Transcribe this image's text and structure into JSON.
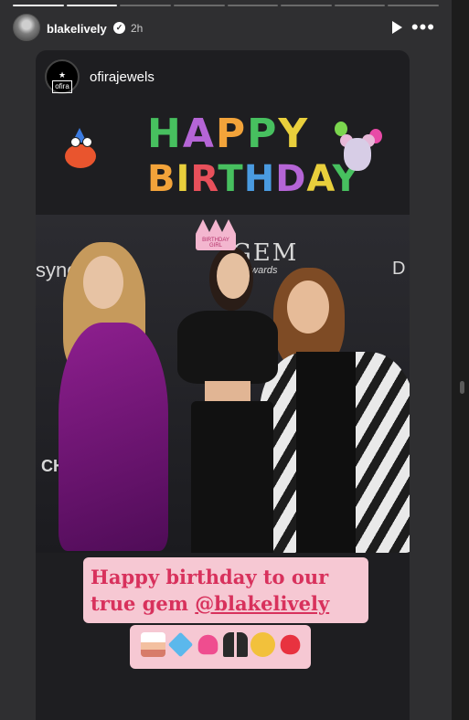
{
  "story": {
    "progress_segments": 8,
    "progress_done": 2,
    "username": "blakelively",
    "verified": true,
    "time": "2h",
    "play_icon": "play-icon",
    "more_icon": "more-icon"
  },
  "shared_post": {
    "account_name": "ofirajewels",
    "avatar_logo": "ofira",
    "banner": {
      "line1": "HAPPY",
      "line2": "BIRTHDAY"
    },
    "photo": {
      "backdrop_sponsor": "synchr",
      "backdrop_gem": "GEM",
      "backdrop_gem_sub": "Awards",
      "backdrop_brand_d": "D",
      "backdrop_brand_ch": "CH",
      "crown_text": "BIRTHDAY GIRL"
    },
    "caption": {
      "line1": "Happy birthday to our",
      "line2_prefix": "true gem ",
      "mention": "@blakelively"
    },
    "emojis": [
      "cake",
      "gem",
      "heart",
      "dancers",
      "party-face",
      "balloon"
    ]
  },
  "colors": {
    "background": "#2f2f31",
    "caption_bg": "#f6c8d3",
    "caption_text": "#d8315c",
    "dress": "#8e1f8f"
  }
}
